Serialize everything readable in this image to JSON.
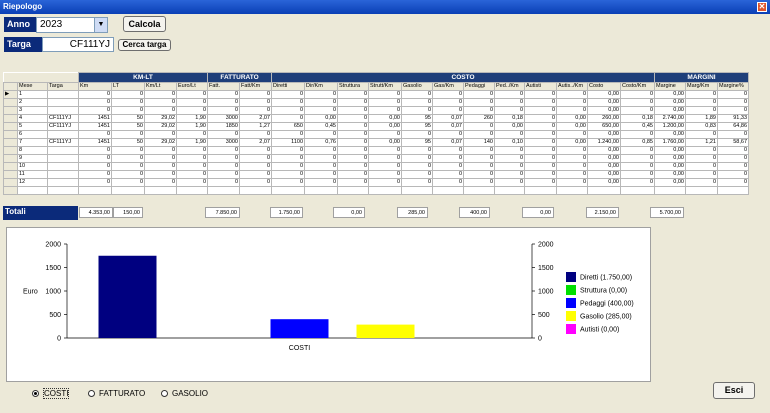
{
  "window": {
    "title": "Riepologo",
    "close": "✕"
  },
  "filters": {
    "anno_label": "Anno",
    "anno_value": "2023",
    "targa_label": "Targa",
    "targa_value": "CF111YJ"
  },
  "buttons": {
    "calcola": "Calcola",
    "cerca_targa": "Cerca targa",
    "esci": "Esci"
  },
  "groups": {
    "kmlt": "KM-LT",
    "fatturato": "FATTURATO",
    "costo": "COSTO",
    "margini": "MARGINI"
  },
  "columns": [
    "Mese",
    "Targa",
    "Km",
    "LT",
    "Km/Lt",
    "Euro/Lt",
    "Fatt.",
    "Fatt/Km",
    "Diretti",
    "Dir/Km",
    "Struttura",
    "Strutt/Km",
    "Gasolio",
    "Gas/Km",
    "Pedaggi",
    "Ped../Km",
    "Autisti",
    "Autis../Km",
    "Costo",
    "Costo/Km",
    "Margine",
    "Marg/Km",
    "Margine%"
  ],
  "rows": [
    [
      "1",
      "",
      "0",
      "0",
      "0",
      "0",
      "0",
      "0",
      "0",
      "0",
      "0",
      "0",
      "0",
      "0",
      "0",
      "0",
      "0",
      "0",
      "0,00",
      "0",
      "0,00",
      "0",
      "0"
    ],
    [
      "2",
      "",
      "0",
      "0",
      "0",
      "0",
      "0",
      "0",
      "0",
      "0",
      "0",
      "0",
      "0",
      "0",
      "0",
      "0",
      "0",
      "0",
      "0,00",
      "0",
      "0,00",
      "0",
      "0"
    ],
    [
      "3",
      "",
      "0",
      "0",
      "0",
      "0",
      "0",
      "0",
      "0",
      "0",
      "0",
      "0",
      "0",
      "0",
      "0",
      "0",
      "0",
      "0",
      "0,00",
      "0",
      "0,00",
      "0",
      "0"
    ],
    [
      "4",
      "CF111YJ",
      "1451",
      "50",
      "29,02",
      "1,90",
      "3000",
      "2,07",
      "0",
      "0,00",
      "0",
      "0,00",
      "95",
      "0,07",
      "260",
      "0,18",
      "0",
      "0,00",
      "260,00",
      "0,18",
      "2.740,00",
      "1,89",
      "91,33"
    ],
    [
      "5",
      "CF111YJ",
      "1451",
      "50",
      "29,02",
      "1,90",
      "1850",
      "1,27",
      "650",
      "0,45",
      "0",
      "0,00",
      "95",
      "0,07",
      "0",
      "0,00",
      "0",
      "0,00",
      "650,00",
      "0,45",
      "1.200,00",
      "0,83",
      "64,86"
    ],
    [
      "6",
      "",
      "0",
      "0",
      "0",
      "0",
      "0",
      "0",
      "0",
      "0",
      "0",
      "0",
      "0",
      "0",
      "0",
      "0",
      "0",
      "0",
      "0,00",
      "0",
      "0,00",
      "0",
      "0"
    ],
    [
      "7",
      "CF111YJ",
      "1451",
      "50",
      "29,02",
      "1,90",
      "3000",
      "2,07",
      "1100",
      "0,76",
      "0",
      "0,00",
      "95",
      "0,07",
      "140",
      "0,10",
      "0",
      "0,00",
      "1.240,00",
      "0,85",
      "1.760,00",
      "1,21",
      "58,67"
    ],
    [
      "8",
      "",
      "0",
      "0",
      "0",
      "0",
      "0",
      "0",
      "0",
      "0",
      "0",
      "0",
      "0",
      "0",
      "0",
      "0",
      "0",
      "0",
      "0,00",
      "0",
      "0,00",
      "0",
      "0"
    ],
    [
      "9",
      "",
      "0",
      "0",
      "0",
      "0",
      "0",
      "0",
      "0",
      "0",
      "0",
      "0",
      "0",
      "0",
      "0",
      "0",
      "0",
      "0",
      "0,00",
      "0",
      "0,00",
      "0",
      "0"
    ],
    [
      "10",
      "",
      "0",
      "0",
      "0",
      "0",
      "0",
      "0",
      "0",
      "0",
      "0",
      "0",
      "0",
      "0",
      "0",
      "0",
      "0",
      "0",
      "0,00",
      "0",
      "0,00",
      "0",
      "0"
    ],
    [
      "11",
      "",
      "0",
      "0",
      "0",
      "0",
      "0",
      "0",
      "0",
      "0",
      "0",
      "0",
      "0",
      "0",
      "0",
      "0",
      "0",
      "0",
      "0,00",
      "0",
      "0,00",
      "0",
      "0"
    ],
    [
      "12",
      "",
      "0",
      "0",
      "0",
      "0",
      "0",
      "0",
      "0",
      "0",
      "0",
      "0",
      "0",
      "0",
      "0",
      "0",
      "0",
      "0",
      "0,00",
      "0",
      "0,00",
      "0",
      "0"
    ],
    [
      "",
      "",
      "",
      "",
      "",
      "",
      "",
      "",
      "",
      "",
      "",
      "",
      "",
      "",
      "",
      "",
      "",
      "",
      "",
      "",
      "",
      "",
      ""
    ]
  ],
  "totals": {
    "label": "Totali",
    "km": "4.353,00",
    "lt": "150,00",
    "fatt": "7.850,00",
    "diretti": "1.750,00",
    "struttura": "0,00",
    "gasolio": "285,00",
    "pedaggi": "400,00",
    "autisti": "0,00",
    "costo": "2.150,00",
    "margine": "5.700,00"
  },
  "chart_data": {
    "type": "bar",
    "categories": [
      "COSTI"
    ],
    "series": [
      {
        "name": "Diretti (1.750,00)",
        "values": [
          1750
        ],
        "color": "#000080"
      },
      {
        "name": "Struttura (0,00)",
        "values": [
          0
        ],
        "color": "#00e000"
      },
      {
        "name": "Pedaggi (400,00)",
        "values": [
          400
        ],
        "color": "#0000ff"
      },
      {
        "name": "Gasolio (285,00)",
        "values": [
          285
        ],
        "color": "#ffff00"
      },
      {
        "name": "Autisti (0,00)",
        "values": [
          0
        ],
        "color": "#ff00ff"
      }
    ],
    "ylabel": "Euro",
    "ylim": [
      0,
      2000
    ],
    "yticks": [
      "0",
      "500",
      "1000",
      "1500",
      "2000"
    ],
    "legend": "right",
    "grid": false
  },
  "radios": {
    "costi": "COSTI",
    "fatturato": "FATTURATO",
    "gasolio": "GASOLIO",
    "selected": "costi"
  }
}
